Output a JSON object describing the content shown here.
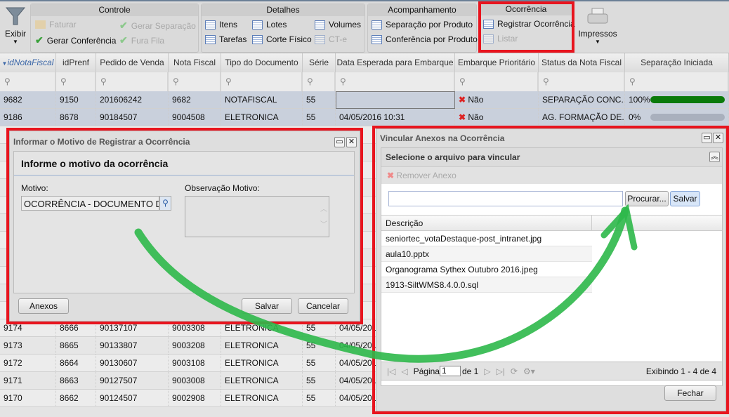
{
  "toolbar": {
    "exibir": "Exibir",
    "controle": {
      "title": "Controle",
      "faturar": "Faturar",
      "gerar_separacao": "Gerar Separação",
      "gerar_conferencia": "Gerar Conferência",
      "fura_fila": "Fura Fila"
    },
    "detalhes": {
      "title": "Detalhes",
      "itens": "Itens",
      "lotes": "Lotes",
      "volumes": "Volumes",
      "tarefas": "Tarefas",
      "corte_fisico": "Corte Físico",
      "cte": "CT-e"
    },
    "acompanhamento": {
      "title": "Acompanhamento",
      "separacao": "Separação por Produto",
      "conferencia": "Conferência por Produto"
    },
    "ocorrencia": {
      "title": "Ocorrência",
      "registrar": "Registrar Ocorrência",
      "listar": "Listar"
    },
    "impressos": "Impressos"
  },
  "grid": {
    "columns": [
      "idNotaFiscal",
      "idPrenf",
      "Pedido de Venda",
      "Nota Fiscal",
      "Tipo do Documento",
      "Série",
      "Data Esperada para Embarque",
      "Embarque Prioritário",
      "Status da Nota Fiscal",
      "Separação Iniciada"
    ],
    "rows": [
      [
        "9682",
        "9150",
        "201606242",
        "9682",
        "NOTAFISCAL",
        "55",
        "",
        "Não",
        "SEPARAÇÃO CONC...",
        "100%"
      ],
      [
        "9186",
        "8678",
        "90184507",
        "9004508",
        "ELETRONICA",
        "55",
        "04/05/2016 10:31",
        "Não",
        "AG. FORMAÇÃO DE...",
        "0%"
      ]
    ],
    "progress": [
      1.0,
      0.0
    ],
    "lower_rows": [
      [
        "9174",
        "8666",
        "90137107",
        "9003308",
        "ELETRONICA",
        "55",
        "04/05/201"
      ],
      [
        "9173",
        "8665",
        "90133807",
        "9003208",
        "ELETRONICA",
        "55",
        "04/05/201"
      ],
      [
        "9172",
        "8664",
        "90130607",
        "9003108",
        "ELETRONICA",
        "55",
        "04/05/201"
      ],
      [
        "9171",
        "8663",
        "90127507",
        "9003008",
        "ELETRONICA",
        "55",
        "04/05/201"
      ],
      [
        "9170",
        "8662",
        "90124507",
        "9002908",
        "ELETRONICA",
        "55",
        "04/05/201"
      ]
    ]
  },
  "motivo_dialog": {
    "title": "Informar o Motivo de Registrar a Ocorrência",
    "heading": "Informe o motivo da ocorrência",
    "motivo_label": "Motivo:",
    "motivo_value": "OCORRÊNCIA - DOCUMENTO DANIFICADO",
    "obs_label": "Observação Motivo:",
    "obs_value": "",
    "anexos": "Anexos",
    "salvar": "Salvar",
    "cancelar": "Cancelar"
  },
  "anexos_dialog": {
    "title": "Vincular Anexos na Ocorrência",
    "panel_title": "Selecione o arquivo para vincular",
    "remover": "Remover Anexo",
    "file_value": "",
    "procurar": "Procurar...",
    "salvar": "Salvar",
    "col_descricao": "Descrição",
    "files": [
      "seniortec_votaDestaque-post_intranet.jpg",
      "aula10.pptx",
      "Organograma Sythex Outubro 2016.jpeg",
      "1913-SiltWMS8.4.0.0.sql"
    ],
    "pagina_label": "Página",
    "page": "1",
    "de": "de 1",
    "exibindo": "Exibindo 1 - 4 de 4",
    "fechar": "Fechar"
  },
  "colors": {
    "highlight": "#e8141e",
    "arrow": "#2db84a",
    "progress": "#0a7a0a"
  }
}
